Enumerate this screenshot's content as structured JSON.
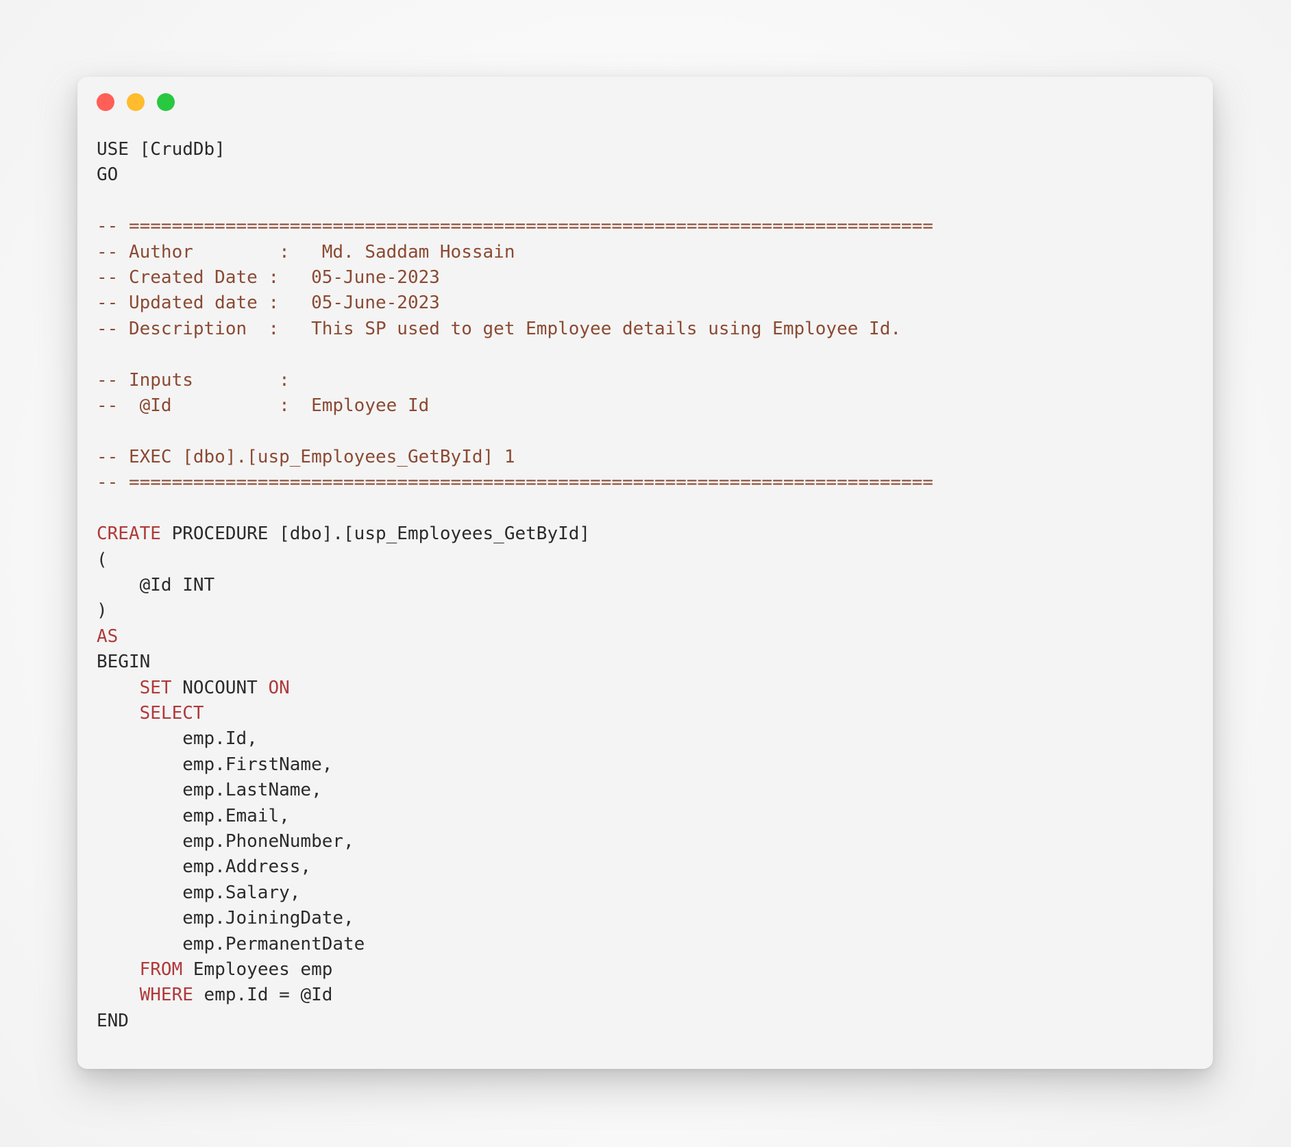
{
  "window": {
    "controls": [
      {
        "name": "close",
        "color": "#ff5f57"
      },
      {
        "name": "minimize",
        "color": "#febc2e"
      },
      {
        "name": "maximize",
        "color": "#28c840"
      }
    ],
    "background": "#f4f4f4"
  },
  "theme": {
    "keyword_color": "#b03a3a",
    "comment_color": "#8b4a33",
    "plain_color": "#2b2b2b",
    "canvas_color": "#fbfbfb"
  },
  "code": {
    "language": "sql",
    "lines": [
      [
        {
          "t": "USE [CrudDb]",
          "c": "pln"
        }
      ],
      [
        {
          "t": "GO",
          "c": "pln"
        }
      ],
      [],
      [
        {
          "t": "-- ===========================================================================",
          "c": "cmt"
        }
      ],
      [
        {
          "t": "-- Author        :   Md. Saddam Hossain",
          "c": "cmt"
        }
      ],
      [
        {
          "t": "-- Created Date :   05-June-2023",
          "c": "cmt"
        }
      ],
      [
        {
          "t": "-- Updated date :   05-June-2023",
          "c": "cmt"
        }
      ],
      [
        {
          "t": "-- Description  :   This SP used to get Employee details using Employee Id.",
          "c": "cmt"
        }
      ],
      [],
      [
        {
          "t": "-- Inputs        :",
          "c": "cmt"
        }
      ],
      [
        {
          "t": "--  @Id          :  Employee Id",
          "c": "cmt"
        }
      ],
      [],
      [
        {
          "t": "-- EXEC [dbo].[usp_Employees_GetById] 1",
          "c": "cmt"
        }
      ],
      [
        {
          "t": "-- ===========================================================================",
          "c": "cmt"
        }
      ],
      [],
      [
        {
          "t": "CREATE",
          "c": "kw"
        },
        {
          "t": " PROCEDURE [dbo].[usp_Employees_GetById]",
          "c": "pln"
        }
      ],
      [
        {
          "t": "(",
          "c": "pln"
        }
      ],
      [
        {
          "t": "    @Id INT",
          "c": "pln"
        }
      ],
      [
        {
          "t": ")",
          "c": "pln"
        }
      ],
      [
        {
          "t": "AS",
          "c": "kw"
        }
      ],
      [
        {
          "t": "BEGIN",
          "c": "pln"
        }
      ],
      [
        {
          "t": "    ",
          "c": "pln"
        },
        {
          "t": "SET",
          "c": "kw"
        },
        {
          "t": " NOCOUNT ",
          "c": "pln"
        },
        {
          "t": "ON",
          "c": "kw"
        }
      ],
      [
        {
          "t": "    ",
          "c": "pln"
        },
        {
          "t": "SELECT",
          "c": "kw"
        }
      ],
      [
        {
          "t": "        emp.Id,",
          "c": "pln"
        }
      ],
      [
        {
          "t": "        emp.FirstName,",
          "c": "pln"
        }
      ],
      [
        {
          "t": "        emp.LastName,",
          "c": "pln"
        }
      ],
      [
        {
          "t": "        emp.Email,",
          "c": "pln"
        }
      ],
      [
        {
          "t": "        emp.PhoneNumber,",
          "c": "pln"
        }
      ],
      [
        {
          "t": "        emp.Address,",
          "c": "pln"
        }
      ],
      [
        {
          "t": "        emp.Salary,",
          "c": "pln"
        }
      ],
      [
        {
          "t": "        emp.JoiningDate,",
          "c": "pln"
        }
      ],
      [
        {
          "t": "        emp.PermanentDate",
          "c": "pln"
        }
      ],
      [
        {
          "t": "    ",
          "c": "pln"
        },
        {
          "t": "FROM",
          "c": "kw"
        },
        {
          "t": " Employees emp",
          "c": "pln"
        }
      ],
      [
        {
          "t": "    ",
          "c": "pln"
        },
        {
          "t": "WHERE",
          "c": "kw"
        },
        {
          "t": " emp.Id = @Id",
          "c": "pln"
        }
      ],
      [
        {
          "t": "END",
          "c": "pln"
        }
      ]
    ]
  }
}
